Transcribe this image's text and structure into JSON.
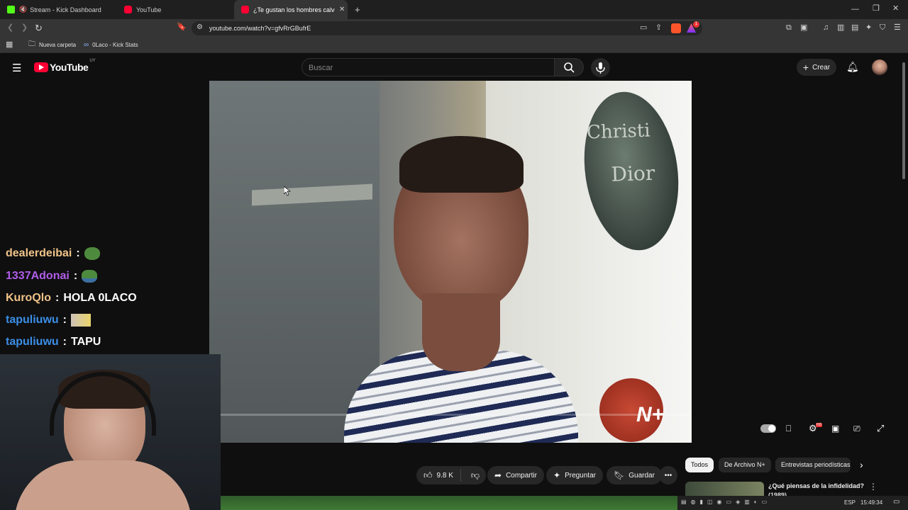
{
  "browser": {
    "tabs": [
      {
        "label": "Stream - Kick Dashboard",
        "icon": "kick-icon"
      },
      {
        "label": "YouTube",
        "icon": "youtube-icon"
      },
      {
        "label": "¿Te gustan los hombres calvos? |",
        "icon": "youtube-icon"
      }
    ],
    "url": "youtube.com/watch?v=gfvRrGBufrE",
    "bookmarks": [
      {
        "label": "Nueva carpeta",
        "icon": "folder-icon"
      },
      {
        "label": "0Laco - Kick Stats",
        "icon": "kick-stats-icon"
      }
    ],
    "notification_badge": "1"
  },
  "youtube": {
    "logo_text": "YouTube",
    "region": "UY",
    "search_placeholder": "Buscar",
    "create_label": "Crear"
  },
  "video": {
    "sign_line1": "Christi",
    "sign_line2": "Dior",
    "watermark": "N+",
    "hd_badge": "HD"
  },
  "chat": [
    {
      "user": "dealerdeibai",
      "message": "",
      "color": "#f0c389",
      "emote": "frog"
    },
    {
      "user": "1337Adonai",
      "message": "",
      "color": "#b05de8",
      "emote": "frog"
    },
    {
      "user": "KuroQlo",
      "message": "HOLA 0LACO",
      "color": "#f0c389",
      "emote": ""
    },
    {
      "user": "tapuliuwu",
      "message": "",
      "color": "#3b8fe8",
      "emote": "cat"
    },
    {
      "user": "tapuliuwu",
      "message": "TAPU",
      "color": "#3b8fe8",
      "emote": ""
    }
  ],
  "actions": {
    "likes": "9.8 K",
    "share": "Compartir",
    "ask": "Preguntar",
    "save": "Guardar"
  },
  "chips": [
    "Todos",
    "De Archivo N+",
    "Entrevistas periodísticas"
  ],
  "recommended": {
    "title": "¿Qué piensas de la infidelidad?",
    "subtitle": "(1989)"
  },
  "taskbar": {
    "lang": "ESP",
    "time": "15:49:34"
  }
}
